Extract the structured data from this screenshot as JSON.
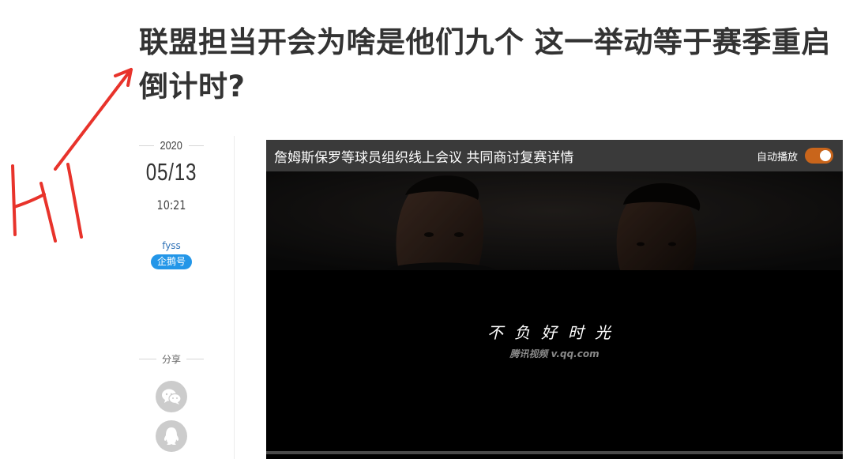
{
  "article": {
    "title": "联盟担当开会为啥是他们九个 这一举动等于赛季重启倒计时?"
  },
  "annotation": {
    "text": "H1",
    "color": "#e8332b"
  },
  "meta": {
    "year": "2020",
    "date": "05/13",
    "time": "10:21",
    "author": "fyss",
    "badge": "企鹅号",
    "share_label": "分享"
  },
  "share": {
    "wechat_icon": "wechat-icon",
    "qq_icon": "qq-icon"
  },
  "video": {
    "title": "詹姆斯保罗等球员组织线上会议 共同商讨复赛详情",
    "autoplay_label": "自动播放",
    "autoplay_on": true,
    "slogan": "不负好时光",
    "brand": "腾讯视频 v.qq.com",
    "accent_color": "#c9651b"
  }
}
